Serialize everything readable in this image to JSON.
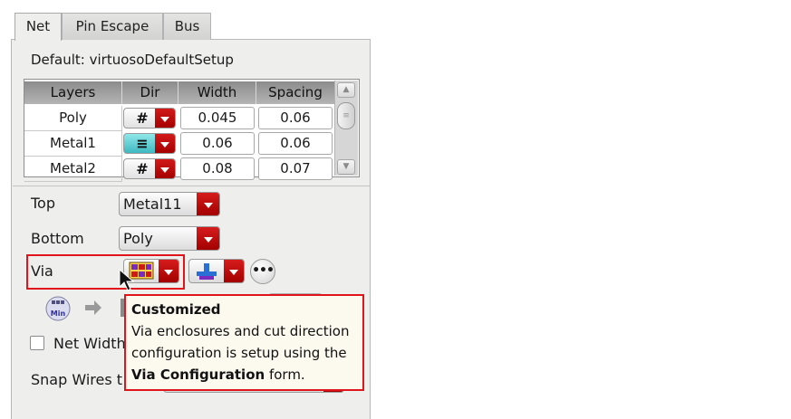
{
  "tabs": [
    {
      "label": "Net",
      "active": true
    },
    {
      "label": "Pin Escape",
      "active": false
    },
    {
      "label": "Bus",
      "active": false
    }
  ],
  "default_setup": "Default: virtuosoDefaultSetup",
  "table": {
    "columns": [
      "Layers",
      "Dir",
      "Width",
      "Spacing"
    ],
    "rows": [
      {
        "layer": "Poly",
        "dir_icon": "grid-icon",
        "dir_glyph": "#",
        "width": "0.045",
        "spacing": "0.06"
      },
      {
        "layer": "Metal1",
        "dir_icon": "horizontal-lines-icon",
        "dir_glyph": "≡",
        "width": "0.06",
        "spacing": "0.06"
      },
      {
        "layer": "Metal2",
        "dir_icon": "grid-icon",
        "dir_glyph": "#",
        "width": "0.08",
        "spacing": "0.07"
      }
    ]
  },
  "form": {
    "top_label": "Top",
    "top_value": "Metal11",
    "bottom_label": "Bottom",
    "bottom_value": "Poly",
    "via_label": "Via",
    "more_glyph": "•••",
    "net_width_label": "Net Width",
    "snap_label": "Snap Wires t",
    "min_icon_text": "Min"
  },
  "tooltip": {
    "title": "Customized",
    "line1": "Via enclosures and cut direction",
    "line2": "configuration is setup using the",
    "line3_bold": "Via Configuration",
    "line3_rest": " form."
  },
  "colors": {
    "accent_red": "#c00000",
    "highlight_red": "#e0141a",
    "teal_selected": "#3fb8c0",
    "panel_bg": "#eeeeec",
    "tooltip_bg": "#fcf9ef"
  }
}
